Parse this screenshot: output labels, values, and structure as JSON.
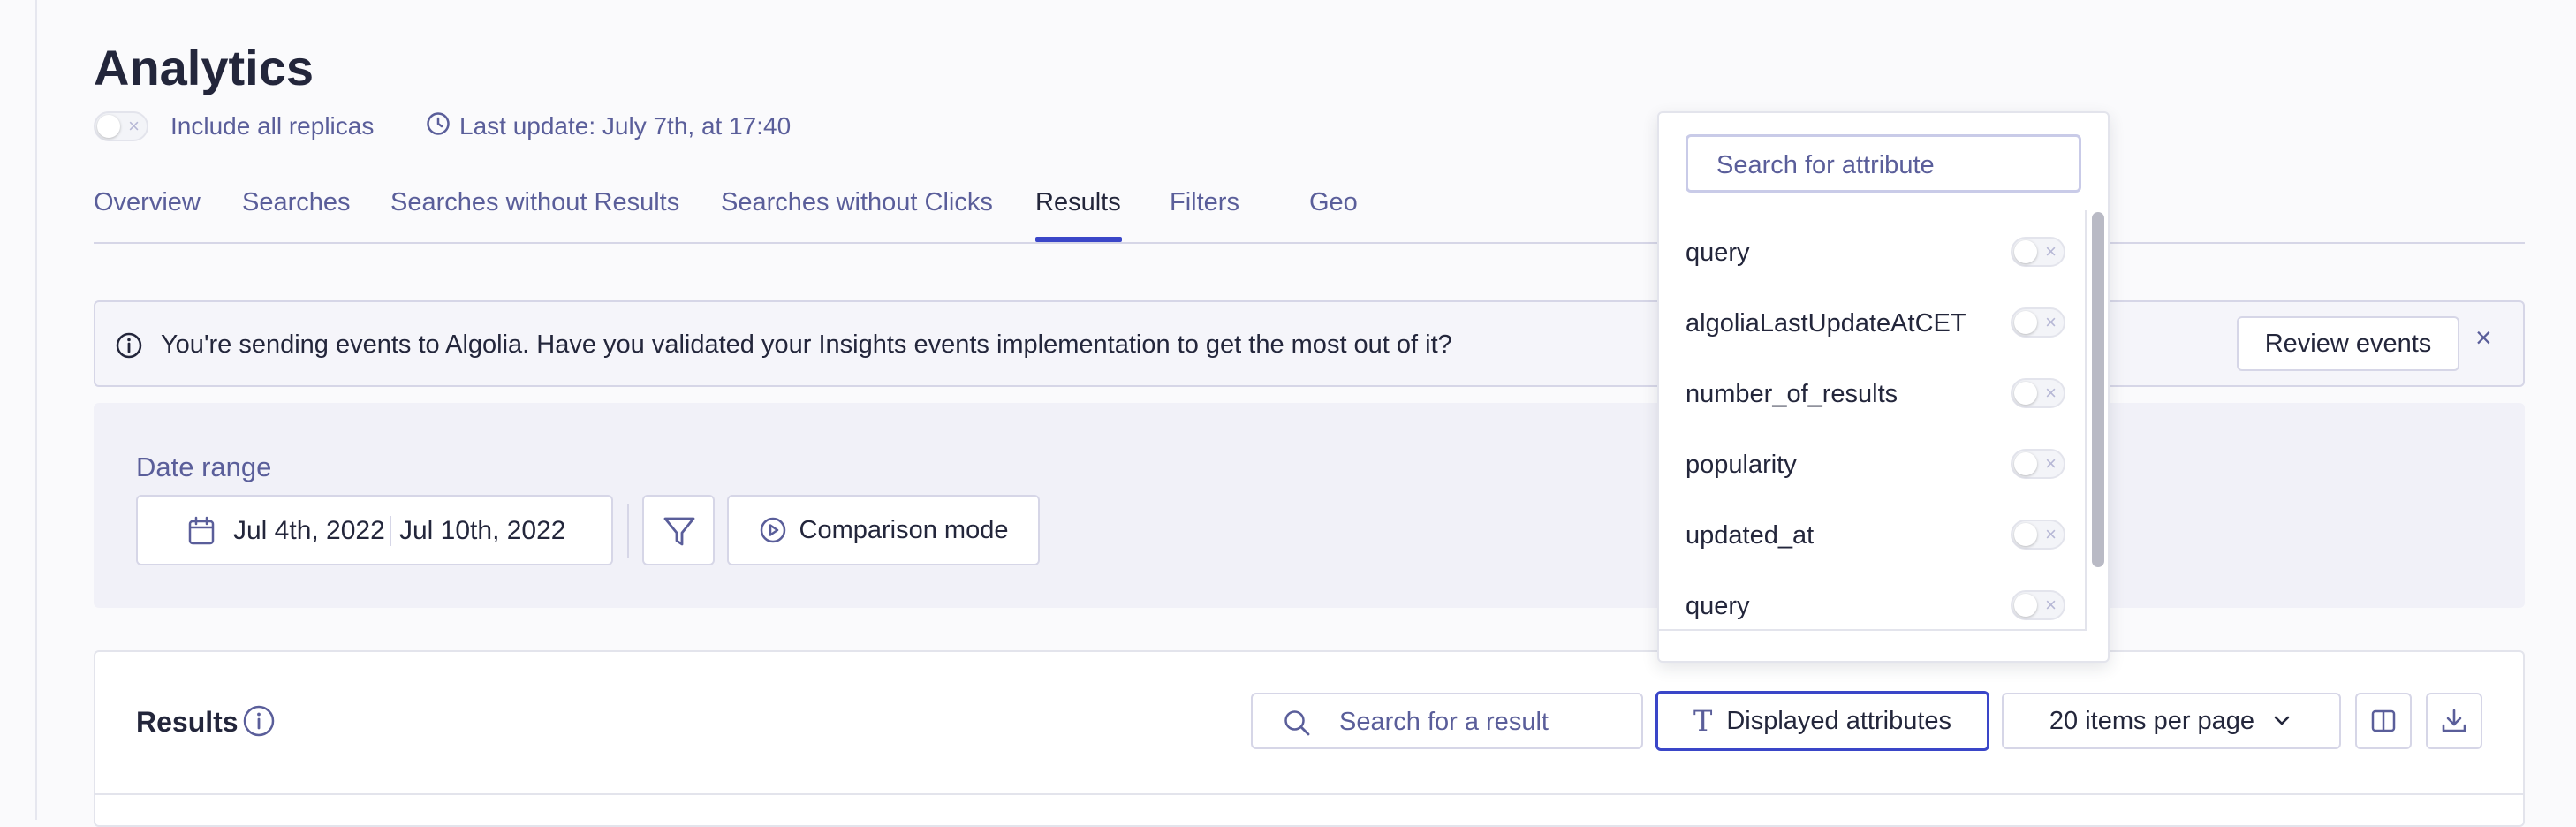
{
  "page": {
    "title": "Analytics",
    "replicas_label": "Include all replicas",
    "last_update": "Last update: July 7th, at 17:40"
  },
  "tabs": [
    {
      "label": "Overview"
    },
    {
      "label": "Searches"
    },
    {
      "label": "Searches without Results"
    },
    {
      "label": "Searches without Clicks"
    },
    {
      "label": "Results",
      "active": true
    },
    {
      "label": "Filters"
    },
    {
      "label": "Geo"
    }
  ],
  "banner": {
    "text": "You're sending events to Algolia. Have you validated your Insights events implementation to get the most out of it?",
    "review_label": "Review events",
    "close_glyph": "×"
  },
  "date_range": {
    "label": "Date range",
    "start": "Jul 4th, 2022",
    "end": "Jul 10th, 2022",
    "comparison_label": "Comparison mode"
  },
  "results": {
    "title": "Results",
    "search_placeholder": "Search for a result",
    "displayed_attributes_label": "Displayed attributes",
    "items_per_page_label": "20 items per page"
  },
  "attribute_dropdown": {
    "search_placeholder": "Search for attribute",
    "items": [
      {
        "name": "query"
      },
      {
        "name": "algoliaLastUpdateAtCET"
      },
      {
        "name": "number_of_results"
      },
      {
        "name": "popularity"
      },
      {
        "name": "updated_at"
      },
      {
        "name": "query"
      }
    ]
  },
  "colors": {
    "accent": "#3a46c8",
    "text": "#23263b",
    "muted": "#5a5e9a",
    "border": "#d6d6e7"
  },
  "icons": {
    "clock": "clock-icon",
    "info": "info-icon",
    "calendar": "calendar-icon",
    "filter": "filter-icon",
    "play": "play-circle-icon",
    "search": "search-icon",
    "text": "text-icon",
    "chevron": "chevron-down-icon",
    "columns": "columns-icon",
    "download": "download-icon"
  }
}
